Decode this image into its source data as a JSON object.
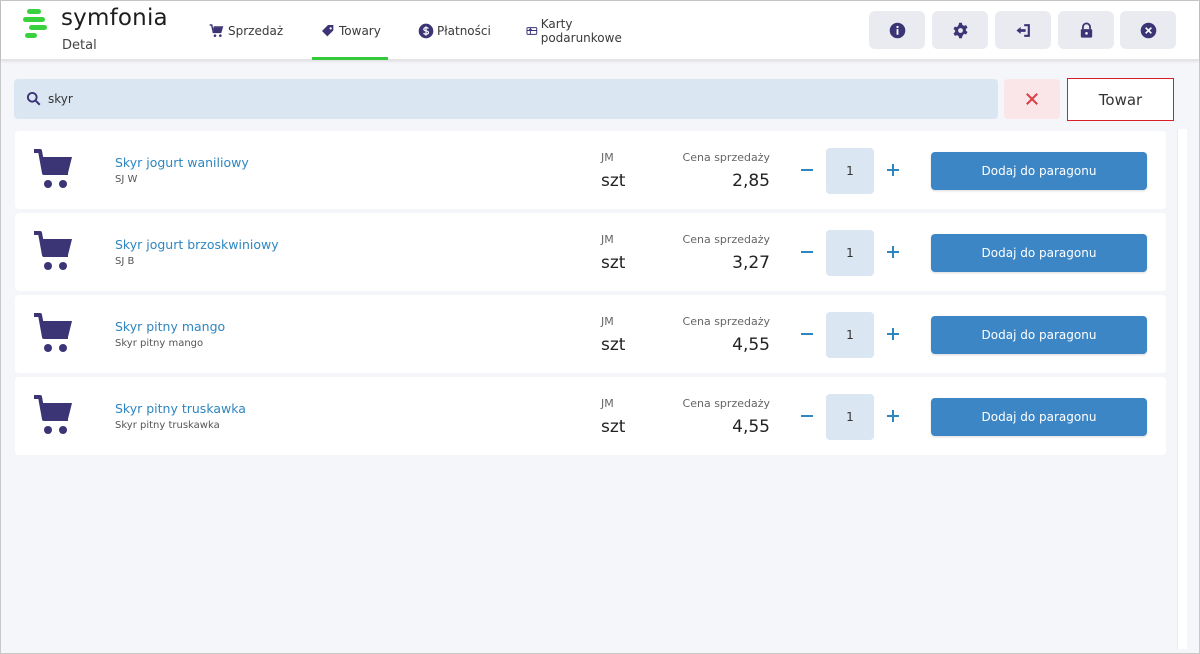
{
  "brand": {
    "name": "symfonia",
    "module": "Detal",
    "accent": "#3ad13f"
  },
  "nav": {
    "tabs": [
      {
        "label": "Sprzedaż",
        "icon": "cart-icon"
      },
      {
        "label": "Towary",
        "icon": "tag-icon",
        "active": true
      },
      {
        "label": "Płatności",
        "icon": "dollar-icon"
      },
      {
        "label": "Karty podarunkowe",
        "icon": "gift-card-icon"
      }
    ]
  },
  "header_buttons": [
    "info-icon",
    "gear-icon",
    "logout-icon",
    "lock-icon",
    "close-icon"
  ],
  "search": {
    "value": "skyr",
    "placeholder": ""
  },
  "mode_button": "Towar",
  "columns": {
    "unit_label": "JM",
    "price_label": "Cena sprzedaży"
  },
  "add_label": "Dodaj do paragonu",
  "products": [
    {
      "name": "Skyr jogurt waniliowy",
      "code": "SJ W",
      "unit": "szt",
      "price": "2,85",
      "qty": "1"
    },
    {
      "name": "Skyr jogurt brzoskwiniowy",
      "code": "SJ B",
      "unit": "szt",
      "price": "3,27",
      "qty": "1"
    },
    {
      "name": "Skyr pitny mango",
      "code": "Skyr pitny mango",
      "unit": "szt",
      "price": "4,55",
      "qty": "1"
    },
    {
      "name": "Skyr pitny truskawka",
      "code": "Skyr pitny truskawka",
      "unit": "szt",
      "price": "4,55",
      "qty": "1"
    }
  ],
  "colors": {
    "icon": "#3b3576",
    "link": "#2e86c1",
    "button": "#3d86c6",
    "highlight_border": "#d71f26"
  }
}
